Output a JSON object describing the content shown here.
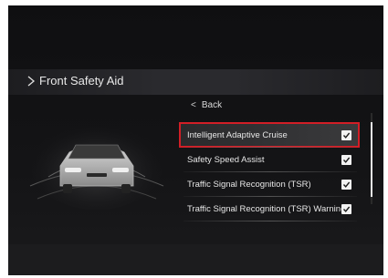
{
  "header": {
    "title": "Front Safety Aid"
  },
  "menu": {
    "back_label": "Back",
    "items": [
      {
        "label": "Intelligent Adaptive Cruise",
        "checked": true,
        "selected": true
      },
      {
        "label": "Safety Speed Assist",
        "checked": true,
        "selected": false
      },
      {
        "label": "Traffic Signal Recognition (TSR)",
        "checked": true,
        "selected": false
      },
      {
        "label": "Traffic Signal Recognition (TSR) Warning",
        "checked": true,
        "selected": false
      }
    ]
  },
  "colors": {
    "highlight_border": "#d21e26",
    "background": "#141416",
    "text": "#e6e6e6"
  },
  "icons": {
    "back": "chevron-left-icon",
    "header": "chevron-right-icon",
    "check": "checkbox-checked-icon"
  }
}
